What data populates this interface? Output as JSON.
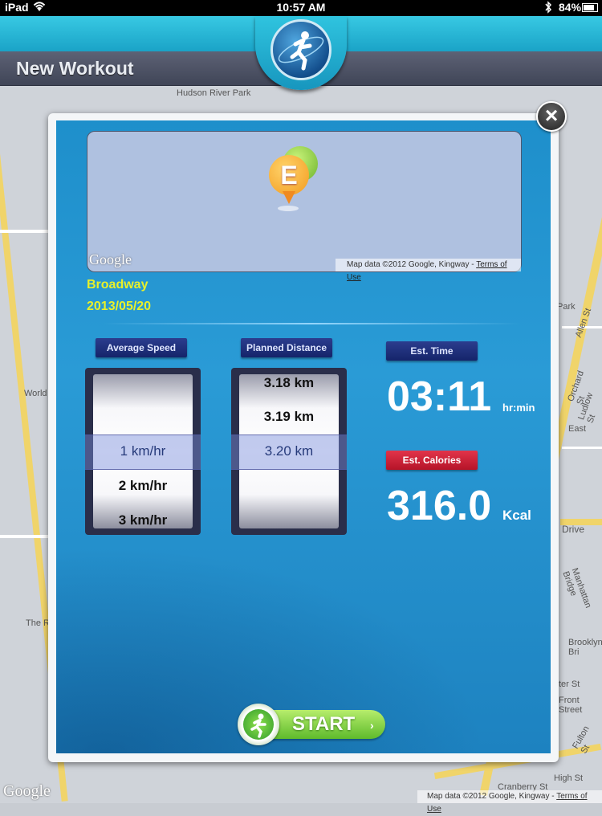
{
  "status_bar": {
    "device": "iPad",
    "time": "10:57 AM",
    "battery": "84%"
  },
  "nav": {
    "title": "New Workout"
  },
  "map": {
    "streets_left": [
      "Hudson River Park",
      "World",
      "The R"
    ],
    "streets_right": [
      "Park",
      "Allen St",
      "Orchard St",
      "Ludlow St",
      "East",
      "Drive",
      "Manhattan Bridge",
      "Brooklyn Bri",
      "ter St",
      "Front Street",
      "Fulton St",
      "High St",
      "Cranberry St"
    ],
    "google": "Google",
    "credit": "Map data ©2012 Google, Kingway -",
    "terms": "Terms of Use"
  },
  "modal": {
    "mini_map": {
      "pin_letter": "E",
      "google": "Google",
      "credit": "Map data ©2012 Google, Kingway -",
      "terms": "Terms of Use"
    },
    "location": "Broadway",
    "date": "2013/05/20",
    "average_speed": {
      "label": "Average Speed",
      "rows": [
        "",
        "1 km/hr",
        "2 km/hr",
        "3 km/hr"
      ],
      "selected": "1 km/hr"
    },
    "planned_distance": {
      "label": "Planned Distance",
      "rows": [
        "3.18 km",
        "3.19 km",
        "3.20 km",
        ""
      ],
      "selected": "3.20 km"
    },
    "est_time": {
      "label": "Est. Time",
      "value": "03:11",
      "unit": "hr:min"
    },
    "est_calories": {
      "label": "Est. Calories",
      "value": "316.0",
      "unit": "Kcal"
    },
    "start_label": "START"
  }
}
